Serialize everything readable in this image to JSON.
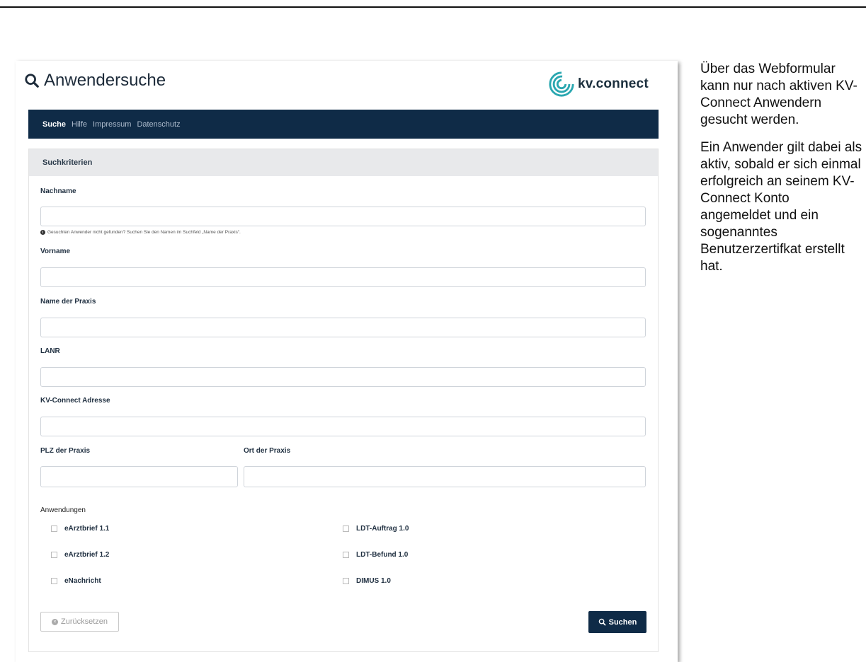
{
  "page": {
    "title": "Anwendersuche",
    "logo_text": "kv.connect"
  },
  "nav": {
    "items": [
      "Suche",
      "Hilfe",
      "Impressum",
      "Datenschutz"
    ]
  },
  "form": {
    "section_title": "Suchkriterien",
    "fields": {
      "nachname": {
        "label": "Nachname",
        "value": ""
      },
      "vorname": {
        "label": "Vorname",
        "value": ""
      },
      "praxis": {
        "label": "Name der Praxis",
        "value": ""
      },
      "lanr": {
        "label": "LANR",
        "value": ""
      },
      "adresse": {
        "label": "KV-Connect Adresse",
        "value": ""
      },
      "plz": {
        "label": "PLZ der Praxis",
        "value": ""
      },
      "ort": {
        "label": "Ort der Praxis",
        "value": ""
      }
    },
    "hint": "Gesuchten Anwender nicht gefunden? Suchen Sie den Namen im Suchfeld „Name der Praxis“.",
    "applications_label": "Anwendungen",
    "applications": [
      {
        "label": "eArztbrief 1.1",
        "checked": false
      },
      {
        "label": "eArztbrief 1.2",
        "checked": false
      },
      {
        "label": "eNachricht",
        "checked": false
      },
      {
        "label": "LDT-Auftrag 1.0",
        "checked": false
      },
      {
        "label": "LDT-Befund 1.0",
        "checked": false
      },
      {
        "label": "DIMUS 1.0",
        "checked": false
      }
    ],
    "reset_label": "Zurücksetzen",
    "search_label": "Suchen"
  },
  "side": {
    "paragraph1": "Über das Webformular kann nur nach aktiven KV-Connect Anwendern gesucht werden.",
    "paragraph2": "Ein Anwender gilt dabei als aktiv, sobald er sich einmal erfolgreich an seinem KV-Connect Konto angemeldet und ein sogenanntes Benutzerzertifkat erstellt hat."
  },
  "colors": {
    "navbar": "#0f2b47",
    "logo_accent": "#2aa7b0"
  },
  "icons": [
    "search-icon",
    "kv-connect-logo-icon",
    "info-icon",
    "reset-icon",
    "checkbox-icon"
  ]
}
